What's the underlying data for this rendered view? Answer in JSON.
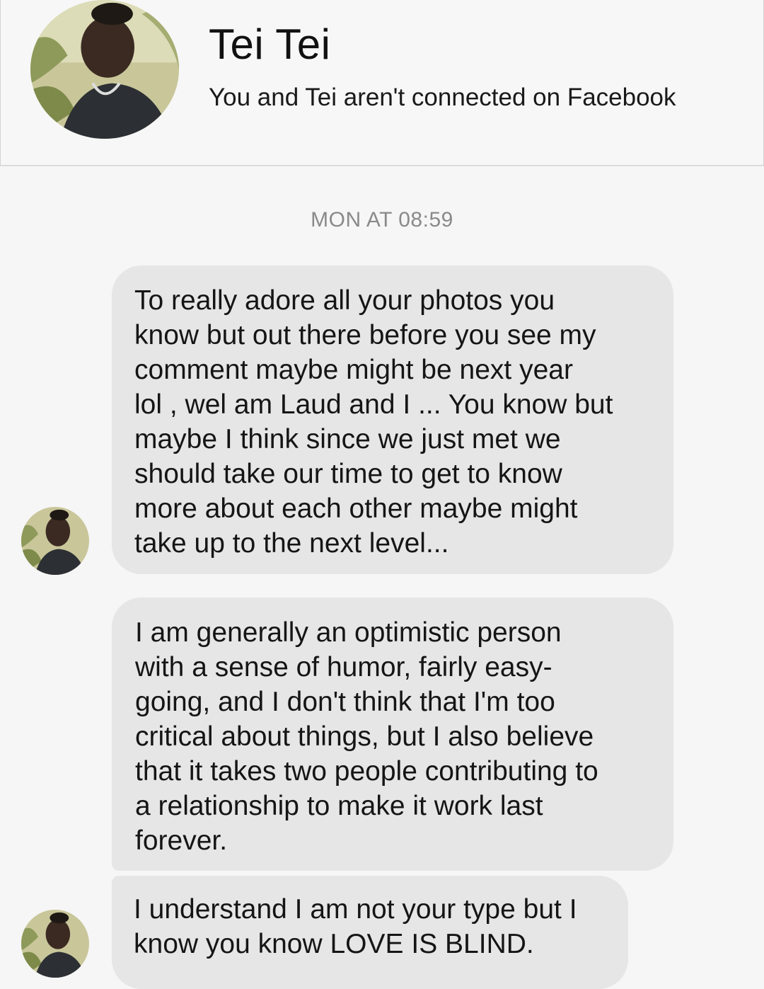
{
  "contact": {
    "name": "Tei Tei",
    "connection_status": "You and Tei aren't connected on Facebook"
  },
  "timestamp": "MON AT 08:59",
  "messages": [
    {
      "lines": [
        "To really adore all your photos you",
        "know but out there before you see my",
        "comment maybe might be next year",
        "lol , wel am Laud and I ... You know but",
        "maybe I think since we just met we",
        "should take our time to get to know",
        "more about each other maybe might",
        "take up to the next level..."
      ]
    },
    {
      "lines": [
        "I am generally an optimistic person",
        "with a sense of humor, fairly easy-",
        "going, and I don't think that I'm too",
        "critical about things, but I also believe",
        "that it takes two people contributing to",
        "a relationship to make it work last",
        "forever."
      ]
    },
    {
      "lines": [
        "I understand I am not your type but I",
        "know you know LOVE IS BLIND."
      ]
    }
  ],
  "colors": {
    "background": "#f6f6f6",
    "bubble": "#e6e6e6",
    "timestamp": "#8a8a8a"
  }
}
